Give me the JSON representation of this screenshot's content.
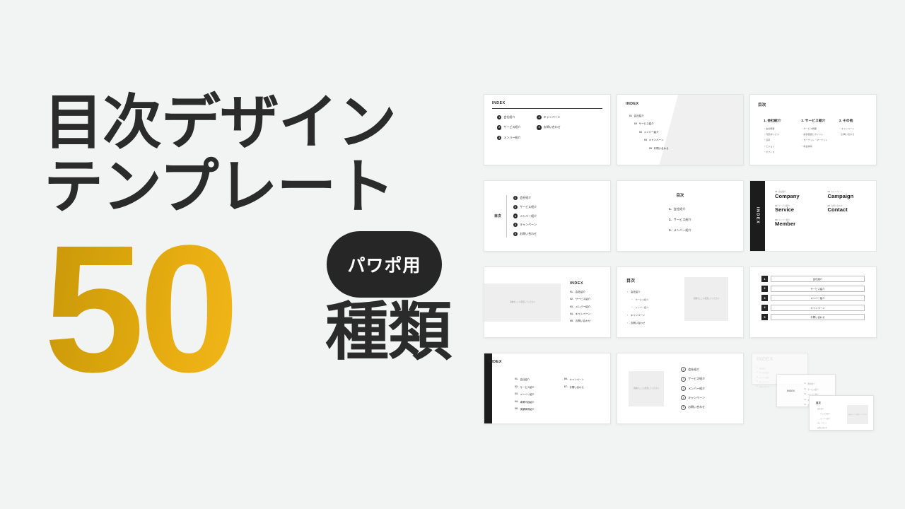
{
  "hero": {
    "title": "目次デザイン\nテンプレート",
    "number": "50",
    "badge": "パワポ用",
    "suffix": "種類",
    "accent_gradient_from": "#c8970a",
    "accent_gradient_to": "#f1b718",
    "badge_bg": "#262626",
    "text_color": "#2b2b2b",
    "background": "#f2f3f3"
  },
  "common": {
    "index_en": "INDEX",
    "index_jp": "目次",
    "image_placeholder": "画像をここに配置してください",
    "items": {
      "company": "会社紹介",
      "service": "サービス紹介",
      "member": "メンバー紹介",
      "campaign": "キャンペーン",
      "contact": "お問い合わせ"
    }
  },
  "slides": [
    {
      "id": "slide-1",
      "title": "INDEX",
      "layout": "two-column-numbered-dots",
      "col_left": [
        {
          "n": "1",
          "label": "会社紹介"
        },
        {
          "n": "2",
          "label": "サービス紹介"
        },
        {
          "n": "3",
          "label": "メンバー紹介"
        }
      ],
      "col_right": [
        {
          "n": "4",
          "label": "キャンペーン"
        },
        {
          "n": "5",
          "label": "お問い合わせ"
        }
      ]
    },
    {
      "id": "slide-2",
      "title": "INDEX",
      "layout": "diagonal-band-staircase",
      "items": [
        {
          "n": "01",
          "label": "会社紹介"
        },
        {
          "n": "02",
          "label": "サービス紹介"
        },
        {
          "n": "03",
          "label": "メンバー紹介"
        },
        {
          "n": "04",
          "label": "キャンペーン"
        },
        {
          "n": "05",
          "label": "お問い合わせ"
        }
      ]
    },
    {
      "id": "slide-3",
      "title": "目次",
      "layout": "three-column-grouped",
      "columns": [
        {
          "head": "1. 会社紹介",
          "subs": [
            "・会社概要",
            "・代表あいさつ",
            "・沿革",
            "・ビジョン",
            "・オフィス"
          ]
        },
        {
          "head": "2. サービス紹介",
          "subs": [
            "・サービス概要",
            "・提供価値とポイント",
            "・ターゲット・マーケット",
            "・料金体系"
          ]
        },
        {
          "head": "3. その他",
          "subs": [
            "・キャンペーン",
            "・お問い合わせ"
          ]
        }
      ]
    },
    {
      "id": "slide-4",
      "title": "目次",
      "layout": "side-label-vertical-rule",
      "items": [
        {
          "n": "1",
          "label": "会社紹介"
        },
        {
          "n": "2",
          "label": "サービス紹介"
        },
        {
          "n": "3",
          "label": "メンバー紹介"
        },
        {
          "n": "4",
          "label": "キャンペーン"
        },
        {
          "n": "5",
          "label": "お問い合わせ"
        }
      ]
    },
    {
      "id": "slide-5",
      "title": "目次",
      "layout": "centered-minimal",
      "items": [
        {
          "n": "1.",
          "label": "会社紹介"
        },
        {
          "n": "2.",
          "label": "サービス紹介"
        },
        {
          "n": "3.",
          "label": "メンバー紹介"
        }
      ]
    },
    {
      "id": "slide-6",
      "title": "INDEX",
      "layout": "dark-vertical-sidebar-bilingual",
      "items": [
        {
          "n": "01",
          "jp": "会社紹介",
          "en": "Company"
        },
        {
          "n": "02",
          "jp": "サービス紹介",
          "en": "Service"
        },
        {
          "n": "03",
          "jp": "メンバー紹介",
          "en": "Member"
        },
        {
          "n": "04",
          "jp": "キャンペーン",
          "en": "Campaign"
        },
        {
          "n": "05",
          "jp": "お問い合わせ",
          "en": "Contact"
        }
      ]
    },
    {
      "id": "slide-7",
      "title": "INDEX",
      "layout": "image-left-list-right",
      "image_caption": "画像をここに配置してください",
      "items": [
        {
          "n": "01.",
          "label": "会社紹介"
        },
        {
          "n": "02.",
          "label": "サービス紹介"
        },
        {
          "n": "03.",
          "label": "メンバー紹介"
        },
        {
          "n": "04.",
          "label": "キャンペーン"
        },
        {
          "n": "05.",
          "label": "お問い合わせ"
        }
      ]
    },
    {
      "id": "slide-8",
      "title": "目次",
      "layout": "nested-bullets-image-right",
      "image_caption": "画像をここに配置してください",
      "items": [
        {
          "bullet": "・",
          "label": "会社紹介",
          "sub": false
        },
        {
          "bullet": "∟",
          "label": "サービス紹介",
          "sub": true
        },
        {
          "bullet": "∟",
          "label": "メンバー紹介",
          "sub": true
        },
        {
          "bullet": "・",
          "label": "キャンペーン",
          "sub": false
        },
        {
          "bullet": "・",
          "label": "お問い合わせ",
          "sub": false
        }
      ]
    },
    {
      "id": "slide-9",
      "title": "",
      "layout": "numbered-square-bars",
      "items": [
        {
          "n": "1",
          "label": "会社紹介"
        },
        {
          "n": "2",
          "label": "サービス紹介"
        },
        {
          "n": "3",
          "label": "メンバー紹介"
        },
        {
          "n": "4",
          "label": "キャンペーン"
        },
        {
          "n": "5",
          "label": "お問い合わせ"
        }
      ]
    },
    {
      "id": "slide-10",
      "title": "INDEX",
      "layout": "black-left-bar-two-column",
      "col_left": [
        {
          "n": "01.",
          "label": "会社紹介"
        },
        {
          "n": "02.",
          "label": "サービス紹介"
        },
        {
          "n": "03.",
          "label": "メンバー紹介"
        },
        {
          "n": "04.",
          "label": "事業内容紹介"
        },
        {
          "n": "05.",
          "label": "実績事例紹介"
        }
      ],
      "col_right": [
        {
          "n": "06.",
          "label": "キャンペーン"
        },
        {
          "n": "07.",
          "label": "お問い合わせ"
        }
      ]
    },
    {
      "id": "slide-11",
      "title": "",
      "layout": "square-image-ring-numbers",
      "image_caption": "画像をここに配置してください",
      "items": [
        {
          "n": "1",
          "label": "会社紹介"
        },
        {
          "n": "2",
          "label": "サービス紹介"
        },
        {
          "n": "3",
          "label": "メンバー紹介"
        },
        {
          "n": "4",
          "label": "キャンペーン"
        },
        {
          "n": "5",
          "label": "お問い合わせ"
        }
      ]
    },
    {
      "id": "slide-12",
      "title": "INDEX",
      "layout": "stacked-cards",
      "cards": [
        {
          "title": "INDEX",
          "items": [
            {
              "n": "1.",
              "label": "会社紹介"
            },
            {
              "n": "2.",
              "label": "サービス紹介"
            },
            {
              "n": "3.",
              "label": "メンバー紹介"
            },
            {
              "n": "4.",
              "label": "キャンペーン"
            },
            {
              "n": "5.",
              "label": "お問い合わせ"
            }
          ]
        },
        {
          "title": "INDEX",
          "items": [
            {
              "n": "01.",
              "label": "会社紹介"
            },
            {
              "n": "02.",
              "label": "サービス紹介"
            },
            {
              "n": "03.",
              "label": "メンバー紹介"
            },
            {
              "n": "04.",
              "label": "キャンペーン"
            },
            {
              "n": "05.",
              "label": "お問い合わせ"
            }
          ]
        },
        {
          "title": "目次",
          "image_caption": "画像をここに配置してください",
          "items": [
            {
              "label": "会社紹介",
              "sub": false
            },
            {
              "label": "サービス紹介",
              "sub": true
            },
            {
              "label": "メンバー紹介",
              "sub": true
            },
            {
              "label": "キャンペーン",
              "sub": false
            },
            {
              "label": "お問い合わせ",
              "sub": false
            }
          ]
        }
      ]
    }
  ]
}
